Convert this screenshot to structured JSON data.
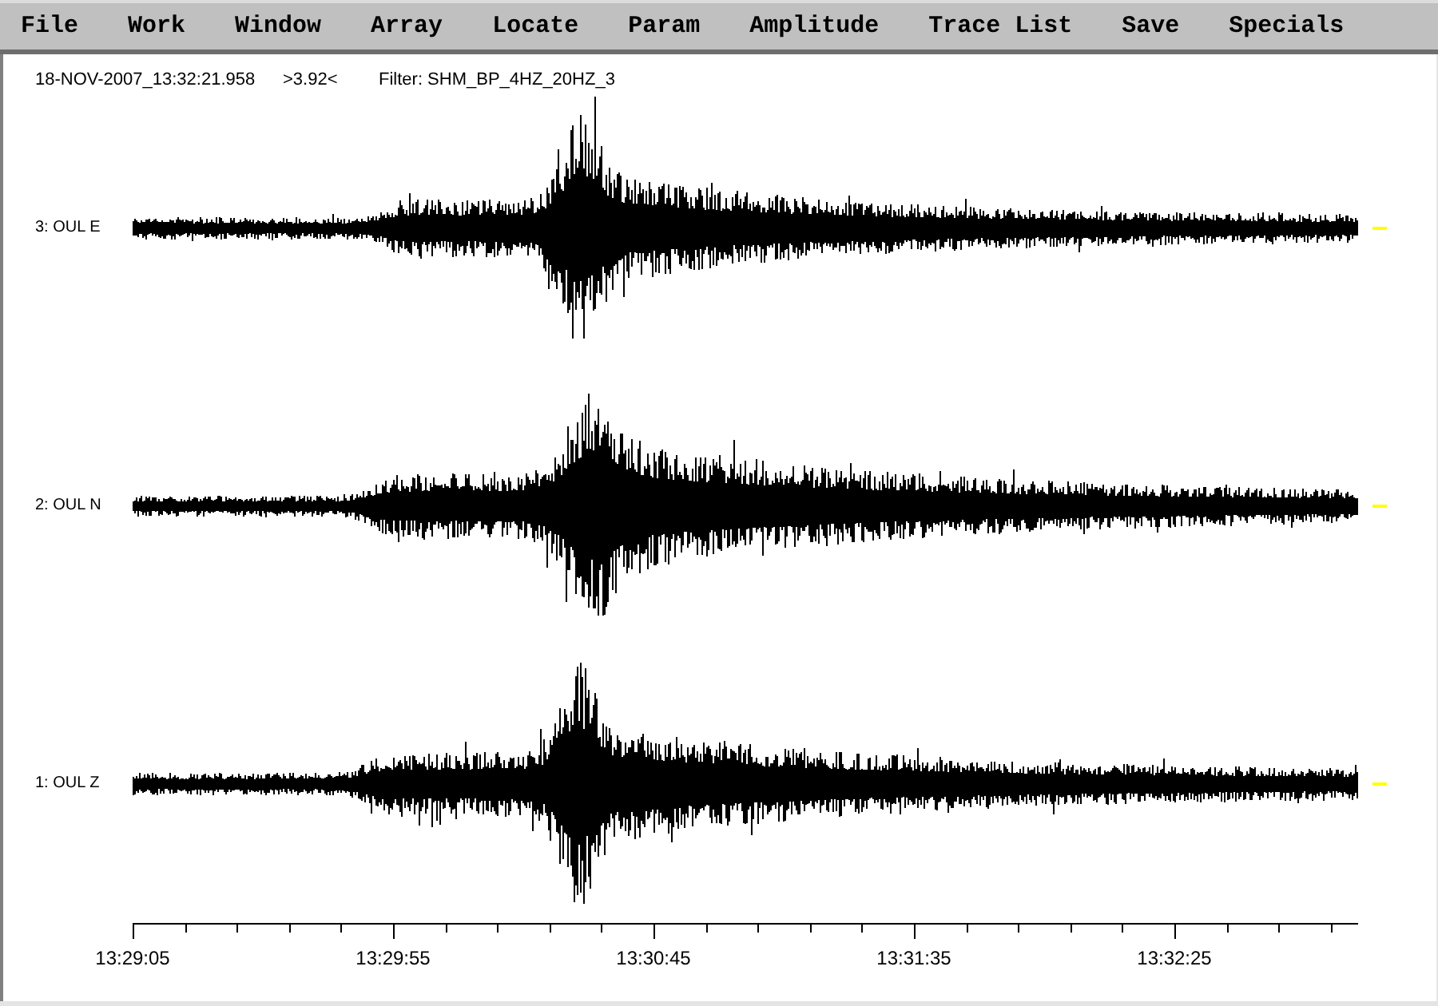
{
  "menu_bar": {
    "items": [
      "File",
      "Work",
      "Window",
      "Array",
      "Locate",
      "Param",
      "Amplitude",
      "Trace List",
      "Save",
      "Specials"
    ]
  },
  "header": {
    "timestamp": "18-NOV-2007_13:32:21.958",
    "amplitude": ">3.92<",
    "filter": "Filter: SHM_BP_4HZ_20HZ_3"
  },
  "traces": [
    {
      "label": "3: OUL E"
    },
    {
      "label": "2: OUL N"
    },
    {
      "label": "1: OUL Z"
    }
  ],
  "time_axis": {
    "labels": [
      "13:29:05",
      "13:29:55",
      "13:30:45",
      "13:31:35",
      "13:32:25"
    ]
  }
}
